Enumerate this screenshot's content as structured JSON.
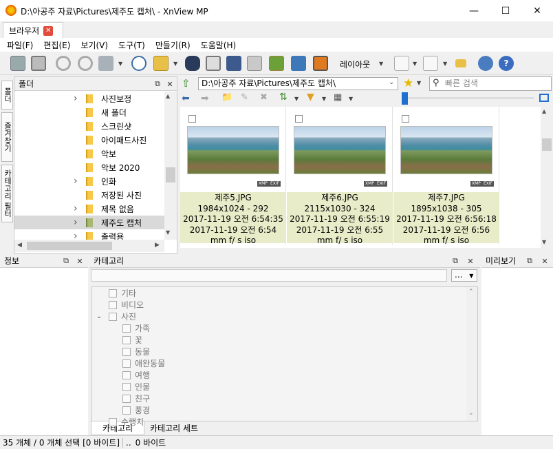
{
  "window": {
    "title": "D:\\아공주 자료\\Pictures\\제주도 캡처\\ - XnView MP"
  },
  "tabs": [
    {
      "label": "브라우저"
    }
  ],
  "menu": [
    "파일(F)",
    "편집(E)",
    "보기(V)",
    "도구(T)",
    "만들기(R)",
    "도움말(H)"
  ],
  "toolbar": {
    "layout_label": "레이아웃"
  },
  "folder_panel": {
    "title": "폴더",
    "items": [
      {
        "label": "사진보정",
        "expandable": true
      },
      {
        "label": "새 폴더",
        "expandable": false
      },
      {
        "label": "스크린샷",
        "expandable": false
      },
      {
        "label": "아이패드사진",
        "expandable": false
      },
      {
        "label": "악보",
        "expandable": false
      },
      {
        "label": "악보 2020",
        "expandable": false
      },
      {
        "label": "인화",
        "expandable": true
      },
      {
        "label": "저장된 사진",
        "expandable": false
      },
      {
        "label": "제목 없음",
        "expandable": true
      },
      {
        "label": "제주도 캡처",
        "expandable": true,
        "selected": true
      },
      {
        "label": "출력용",
        "expandable": true
      }
    ]
  },
  "side_tabs": [
    "폴더",
    "즐겨찾기",
    "카테고리 필터"
  ],
  "browser": {
    "path": "D:\\아공주 자료\\Pictures\\제주도 캡처\\",
    "search_placeholder": "빠른 검색",
    "thumbnails": [
      {
        "name": "제주5.JPG",
        "dims": "1984x1024 - 292",
        "date1": "2017-11-19 오전 6:54:35",
        "date2": "2017-11-19 오전 6:54",
        "exif": "mm f/ s iso",
        "badges": [
          "XMP",
          "EXIF"
        ]
      },
      {
        "name": "제주6.JPG",
        "dims": "2115x1030 - 324",
        "date1": "2017-11-19 오전 6:55:19",
        "date2": "2017-11-19 오전 6:55",
        "exif": "mm f/ s iso",
        "badges": [
          "XMP",
          "EXIF"
        ]
      },
      {
        "name": "제주7.JPG",
        "dims": "1895x1038 - 305",
        "date1": "2017-11-19 오전 6:56:18",
        "date2": "2017-11-19 오전 6:56",
        "exif": "mm f/ s iso",
        "badges": [
          "XMP",
          "EXIF"
        ]
      }
    ]
  },
  "info_panel": {
    "title": "정보"
  },
  "category_panel": {
    "title": "카테고리",
    "more_button": "...",
    "items": [
      {
        "label": "기타",
        "level": 0
      },
      {
        "label": "비디오",
        "level": 0
      },
      {
        "label": "사진",
        "level": 0,
        "expanded": true
      },
      {
        "label": "가족",
        "level": 1
      },
      {
        "label": "꽃",
        "level": 1
      },
      {
        "label": "동물",
        "level": 1
      },
      {
        "label": "애완동물",
        "level": 1
      },
      {
        "label": "여행",
        "level": 1
      },
      {
        "label": "인물",
        "level": 1
      },
      {
        "label": "친구",
        "level": 1
      },
      {
        "label": "풍경",
        "level": 1
      },
      {
        "label": "수행치",
        "level": 0
      }
    ],
    "tabs": [
      "카테고리",
      "카테고리 세트"
    ]
  },
  "preview_panel": {
    "title": "미리보기"
  },
  "status": {
    "left": "35 개체 / 0 개체 선택 [0 바이트]",
    "sep": "..",
    "right": "0 바이트"
  }
}
